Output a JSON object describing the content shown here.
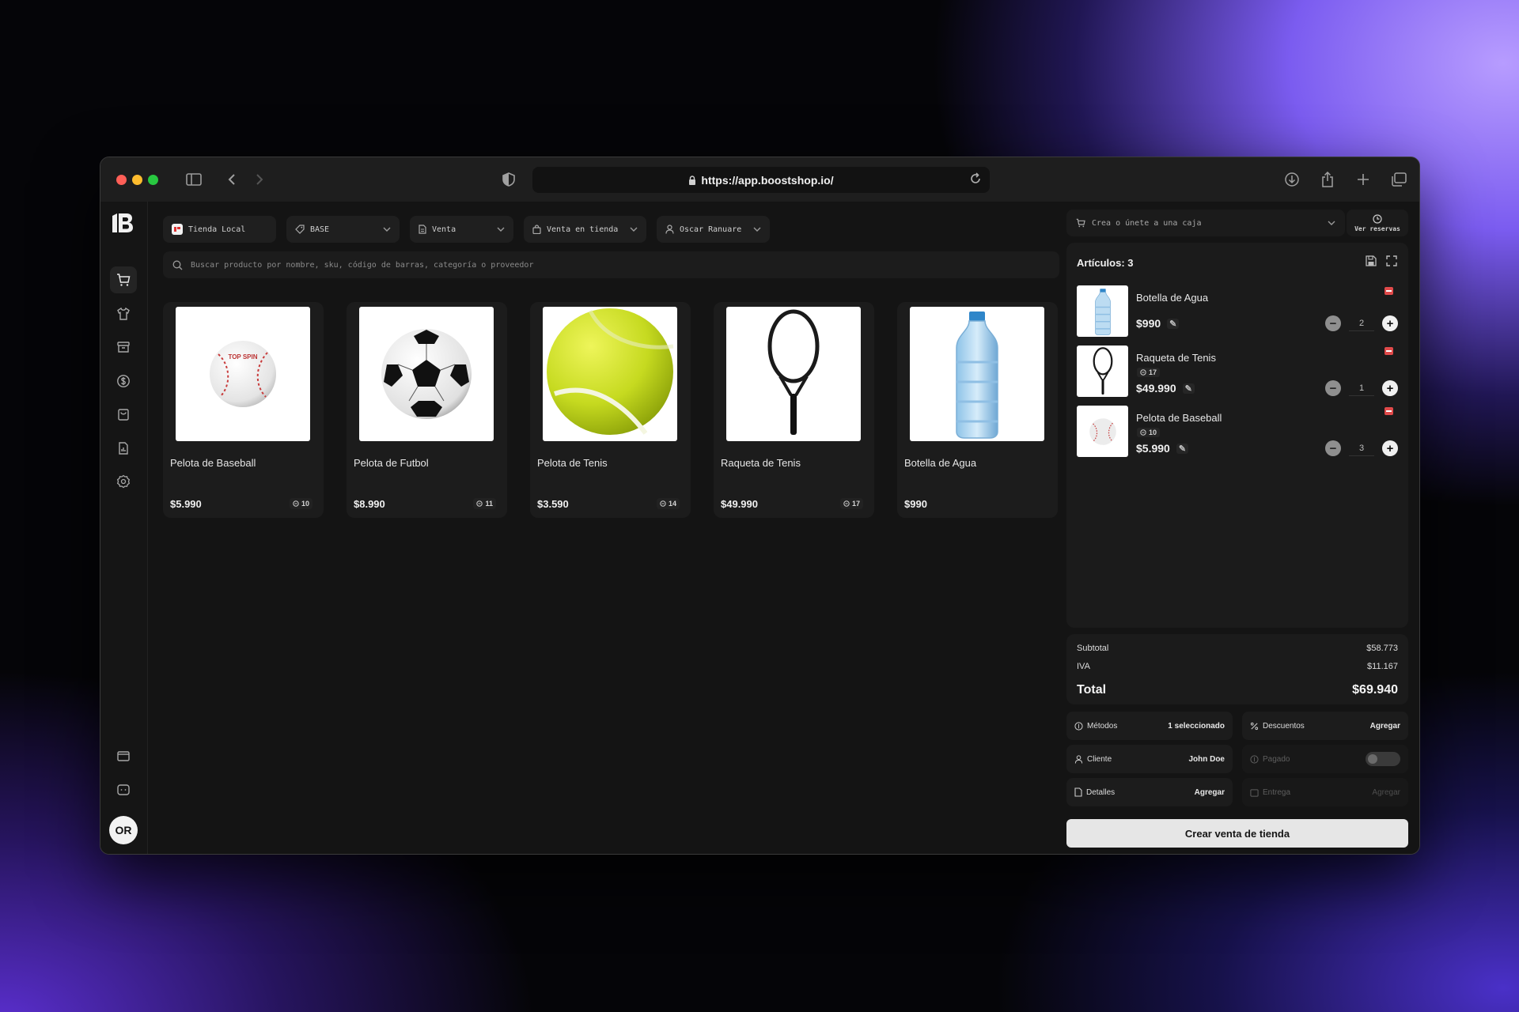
{
  "browser": {
    "url": "https://app.boostshop.io/"
  },
  "filters": {
    "store": "Tienda Local",
    "price_list": "BASE",
    "doc_type": "Venta",
    "sale_mode": "Venta en tienda",
    "seller": "Oscar Ranuare"
  },
  "search": {
    "placeholder": "Buscar producto por nombre, sku, código de barras, categoría o proveedor"
  },
  "products": [
    {
      "name": "Pelota de Baseball",
      "price": "$5.990",
      "stock": "10",
      "image": "baseball"
    },
    {
      "name": "Pelota de Futbol",
      "price": "$8.990",
      "stock": "11",
      "image": "soccer-ball"
    },
    {
      "name": "Pelota de Tenis",
      "price": "$3.590",
      "stock": "14",
      "image": "tennis-ball"
    },
    {
      "name": "Raqueta de Tenis",
      "price": "$49.990",
      "stock": "17",
      "image": "tennis-racket"
    },
    {
      "name": "Botella de Agua",
      "price": "$990",
      "stock": "",
      "image": "water-bottle"
    }
  ],
  "register": {
    "placeholder": "Crea o únete a una caja",
    "reservations_label": "Ver reservas"
  },
  "cart": {
    "title": "Artículos: 3",
    "items": [
      {
        "name": "Botella de Agua",
        "stock": "",
        "price": "$990",
        "qty": "2",
        "image": "water-bottle"
      },
      {
        "name": "Raqueta de Tenis",
        "stock": "17",
        "price": "$49.990",
        "qty": "1",
        "image": "tennis-racket"
      },
      {
        "name": "Pelota de Baseball",
        "stock": "10",
        "price": "$5.990",
        "qty": "3",
        "image": "baseball"
      }
    ]
  },
  "totals": {
    "subtotal_label": "Subtotal",
    "subtotal": "$58.773",
    "tax_label": "IVA",
    "tax": "$11.167",
    "total_label": "Total",
    "total": "$69.940"
  },
  "options": {
    "methods_label": "Métodos",
    "methods_value": "1 seleccionado",
    "discounts_label": "Descuentos",
    "discounts_value": "Agregar",
    "client_label": "Cliente",
    "client_value": "John Doe",
    "paid_label": "Pagado",
    "details_label": "Detalles",
    "details_value": "Agregar",
    "delivery_label": "Entrega",
    "delivery_value": "Agregar"
  },
  "actions": {
    "create_sale": "Crear venta de tienda"
  },
  "user": {
    "initials": "OR"
  },
  "colors": {
    "remove": "#e04a4a",
    "primary_button": "#e6e6e6",
    "tennis_ball": "#cfe22a"
  }
}
